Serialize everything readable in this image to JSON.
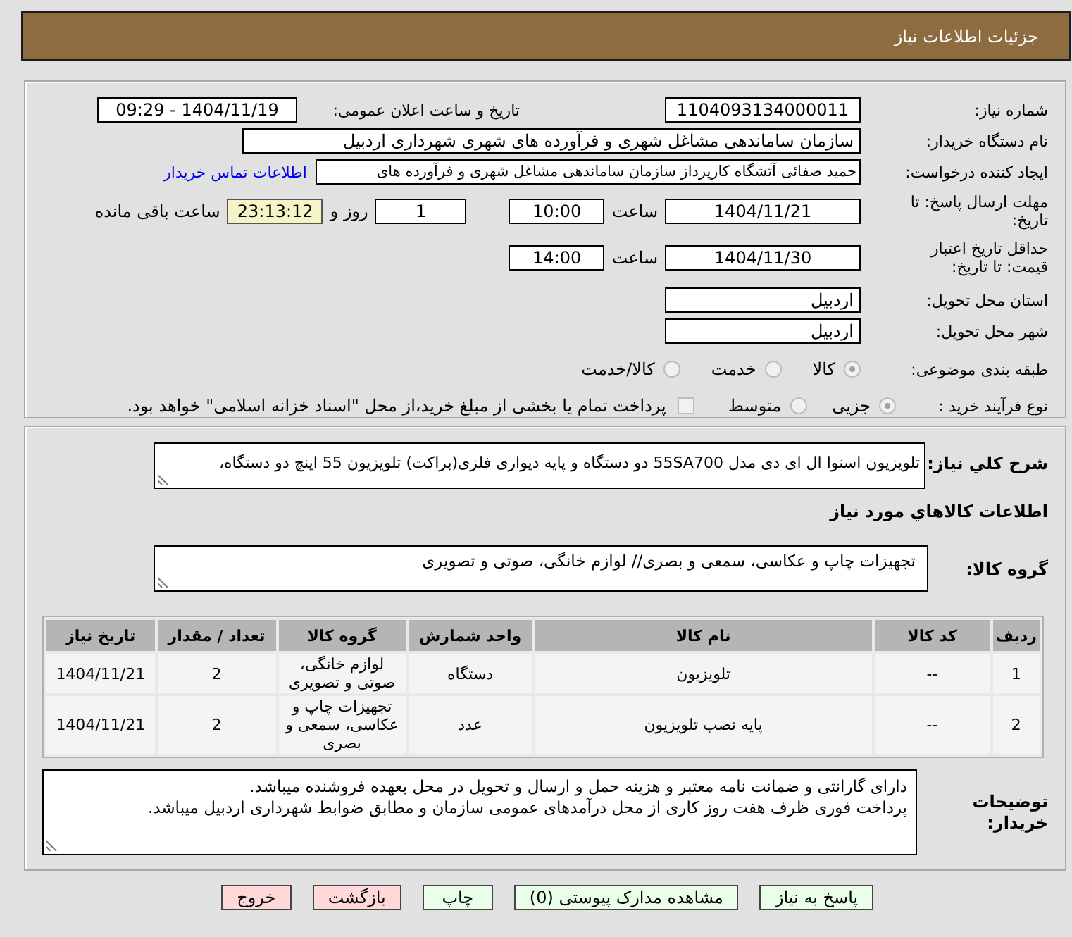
{
  "header": {
    "title": "جزئیات اطلاعات نیاز"
  },
  "details": {
    "need_number": {
      "label": "شماره نیاز:",
      "value": "1104093134000011"
    },
    "announce_datetime": {
      "label": "تاریخ و ساعت اعلان عمومی:",
      "value": "1404/11/19 - 09:29"
    },
    "buyer_org": {
      "label": "نام دستگاه خریدار:",
      "value": "سازمان ساماندهی مشاغل شهری و فرآورده های شهری شهرداری اردبیل"
    },
    "requester": {
      "label": "ایجاد کننده درخواست:",
      "value": "حمید صفائی آتشگاه کارپرداز سازمان ساماندهی مشاغل شهری و فرآورده های",
      "link": "اطلاعات تماس خریدار"
    },
    "response_deadline": {
      "label": "مهلت ارسال پاسخ: تا تاریخ:",
      "date": "1404/11/21",
      "time_label": "ساعت",
      "time": "10:00",
      "days": "1",
      "days_label": "روز و",
      "remaining": "23:13:12",
      "remaining_label": "ساعت باقی مانده"
    },
    "price_validity": {
      "label": "حداقل تاریخ اعتبار قیمت: تا تاریخ:",
      "date": "1404/11/30",
      "time_label": "ساعت",
      "time": "14:00"
    },
    "delivery_province": {
      "label": "استان محل تحویل:",
      "value": "اردبیل"
    },
    "delivery_city": {
      "label": "شهر محل تحویل:",
      "value": "اردبیل"
    },
    "category": {
      "label": "طبقه بندی موضوعی:",
      "options": [
        {
          "label": "کالا",
          "selected": true
        },
        {
          "label": "خدمت",
          "selected": false
        },
        {
          "label": "کالا/خدمت",
          "selected": false
        }
      ]
    },
    "purchase_type": {
      "label": "نوع فرآیند خرید :",
      "options": [
        {
          "label": "جزیی",
          "selected": true
        },
        {
          "label": "متوسط",
          "selected": false
        }
      ],
      "treasury": {
        "label": "پرداخت تمام یا بخشی از مبلغ خرید،از محل \"اسناد خزانه اسلامی\" خواهد بود.",
        "checked": false
      }
    }
  },
  "description": {
    "label": "شرح کلي نياز:",
    "value": "تلویزیون اسنوا ال ای دی مدل 55SA700 دو دستگاه و پایه دیواری فلزی(براکت) تلویزیون 55 اینچ دو دستگاه،"
  },
  "goods_heading": "اطلاعات کالاهاي مورد نياز",
  "goods_group": {
    "label": "گروه کالا:",
    "value": "تجهیزات چاپ و عکاسی، سمعی و بصری// لوازم خانگی، صوتی و تصویری"
  },
  "table": {
    "columns": [
      "ردیف",
      "کد کالا",
      "نام کالا",
      "واحد شمارش",
      "گروه کالا",
      "تعداد / مقدار",
      "تاریخ نیاز"
    ],
    "rows": [
      [
        "1",
        "--",
        "تلویزیون",
        "دستگاه",
        "لوازم خانگی، صوتی و تصویری",
        "2",
        "1404/11/21"
      ],
      [
        "2",
        "--",
        "پایه نصب تلویزیون",
        "عدد",
        "تجهیزات چاپ و عکاسی، سمعی و بصری",
        "2",
        "1404/11/21"
      ]
    ]
  },
  "buyer_notes": {
    "label": "توضیحات خریدار:",
    "lines": [
      "دارای گارانتی و ضمانت نامه معتبر و هزینه حمل و ارسال و تحویل در محل بعهده فروشنده میباشد.",
      "پرداخت فوری ظرف هفت روز کاری از محل درآمدهای عمومی سازمان و مطابق ضوابط شهرداری اردبیل میباشد."
    ]
  },
  "buttons": [
    {
      "label": "پاسخ به نیاز",
      "color": "#eaffea"
    },
    {
      "label": "مشاهده مدارک پیوستی (0)",
      "color": "#eaffea"
    },
    {
      "label": "چاپ",
      "color": "#eaffea"
    },
    {
      "label": "بازگشت",
      "color": "#ffd9d9"
    },
    {
      "label": "خروج",
      "color": "#ffd9d9"
    }
  ]
}
